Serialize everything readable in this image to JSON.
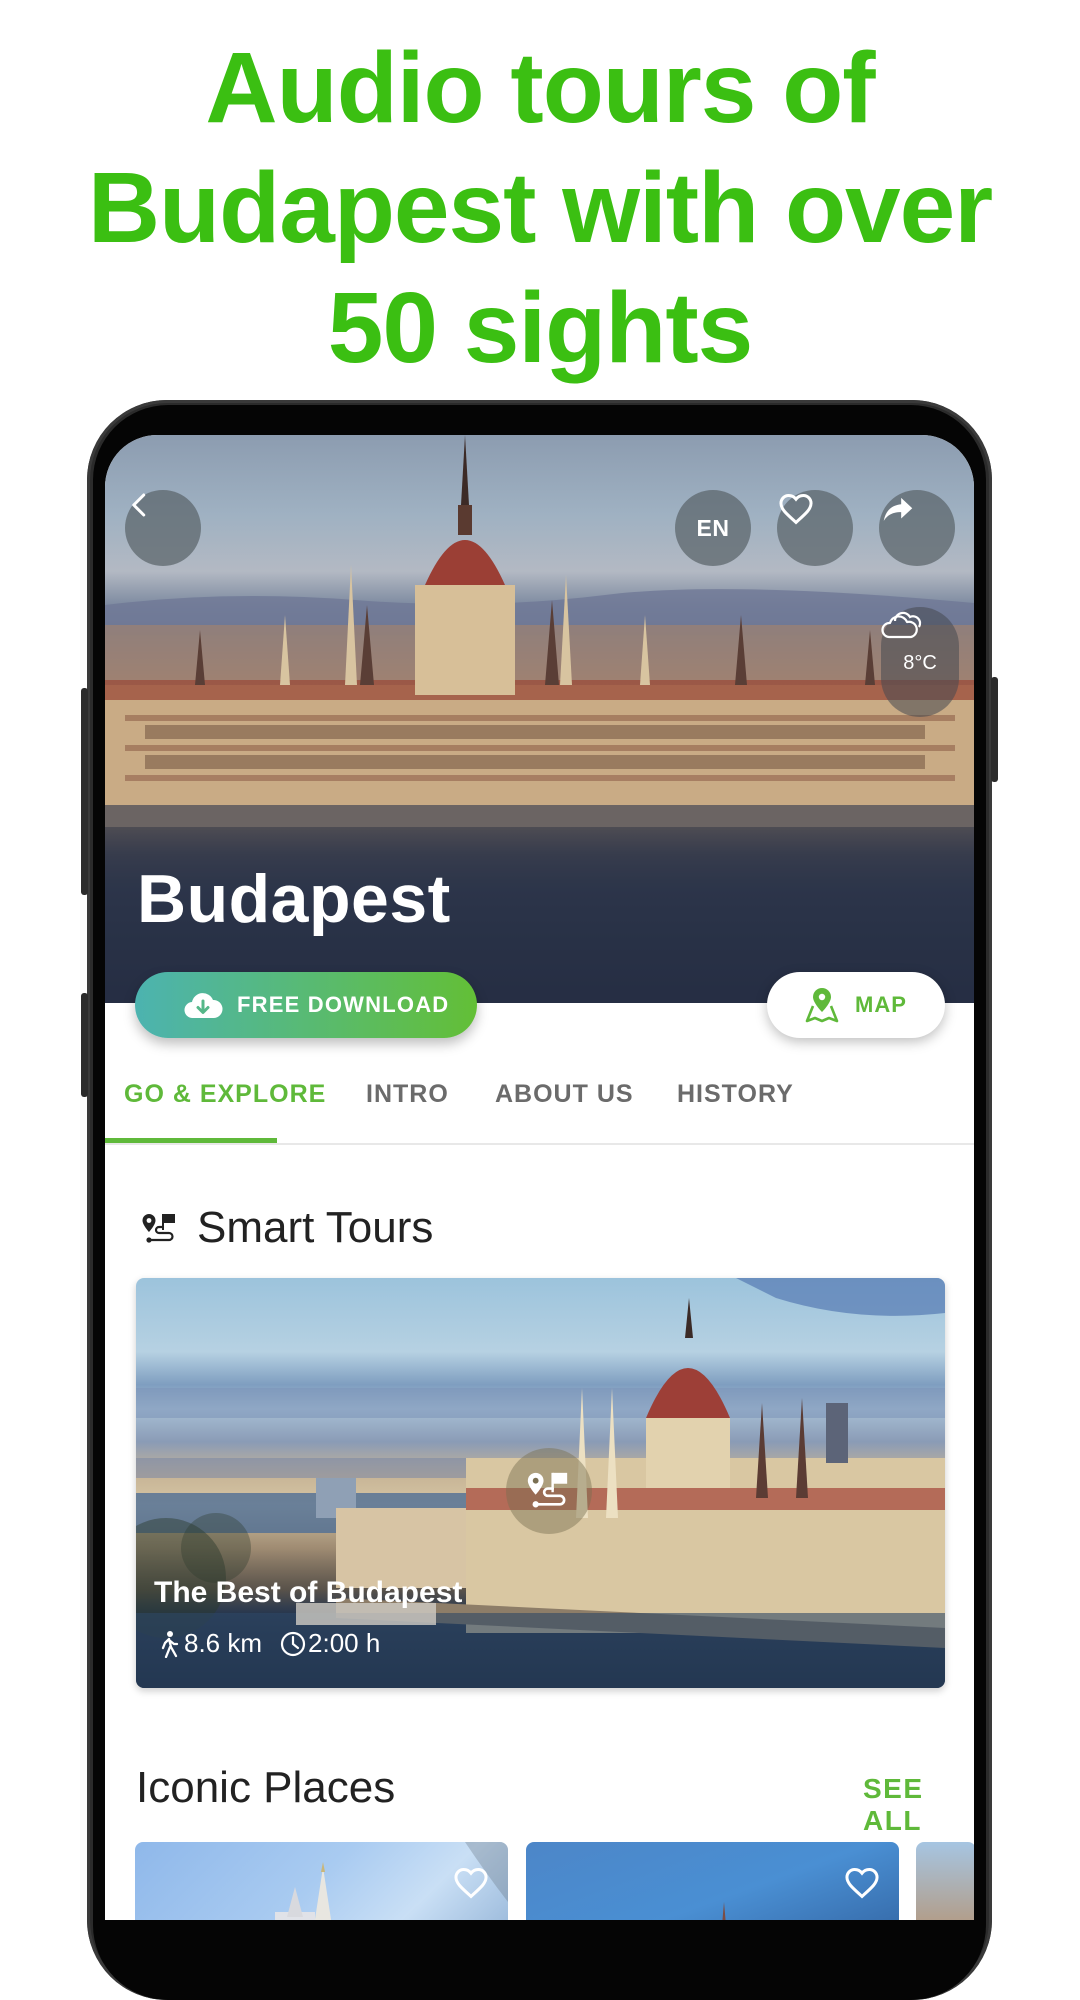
{
  "headline": {
    "lines": [
      "Audio tours of",
      "Budapest with over",
      "50 sights"
    ],
    "color": "#3bbf12"
  },
  "hero": {
    "back_icon": "chevron-left-icon",
    "language": "EN",
    "favorite_icon": "heart-outline-icon",
    "share_icon": "share-arrow-icon",
    "weather": {
      "icon": "cloudy-icon",
      "temperature": "8°C"
    },
    "city": "Budapest"
  },
  "actions": {
    "download": {
      "label": "FREE DOWNLOAD",
      "icon": "cloud-download-icon"
    },
    "map": {
      "label": "MAP",
      "icon": "map-pin-icon"
    }
  },
  "tabs": [
    {
      "label": "GO & EXPLORE",
      "active": true
    },
    {
      "label": "INTRO",
      "active": false
    },
    {
      "label": "ABOUT US",
      "active": false
    },
    {
      "label": "HISTORY",
      "active": false
    }
  ],
  "smart_tours": {
    "title": "Smart Tours",
    "icon": "route-icon",
    "card": {
      "name": "The Best of Budapest",
      "distance": "8.6 km",
      "duration": "2:00 h"
    }
  },
  "iconic_places": {
    "title": "Iconic Places",
    "see_all": "SEE ALL",
    "cards": [
      {
        "favorite_icon": "heart-outline-icon"
      },
      {
        "favorite_icon": "heart-outline-icon"
      },
      {}
    ]
  },
  "colors": {
    "accent_green": "#5fb93a",
    "gradient_start": "#4cb3b0",
    "gradient_end": "#63bf36"
  }
}
